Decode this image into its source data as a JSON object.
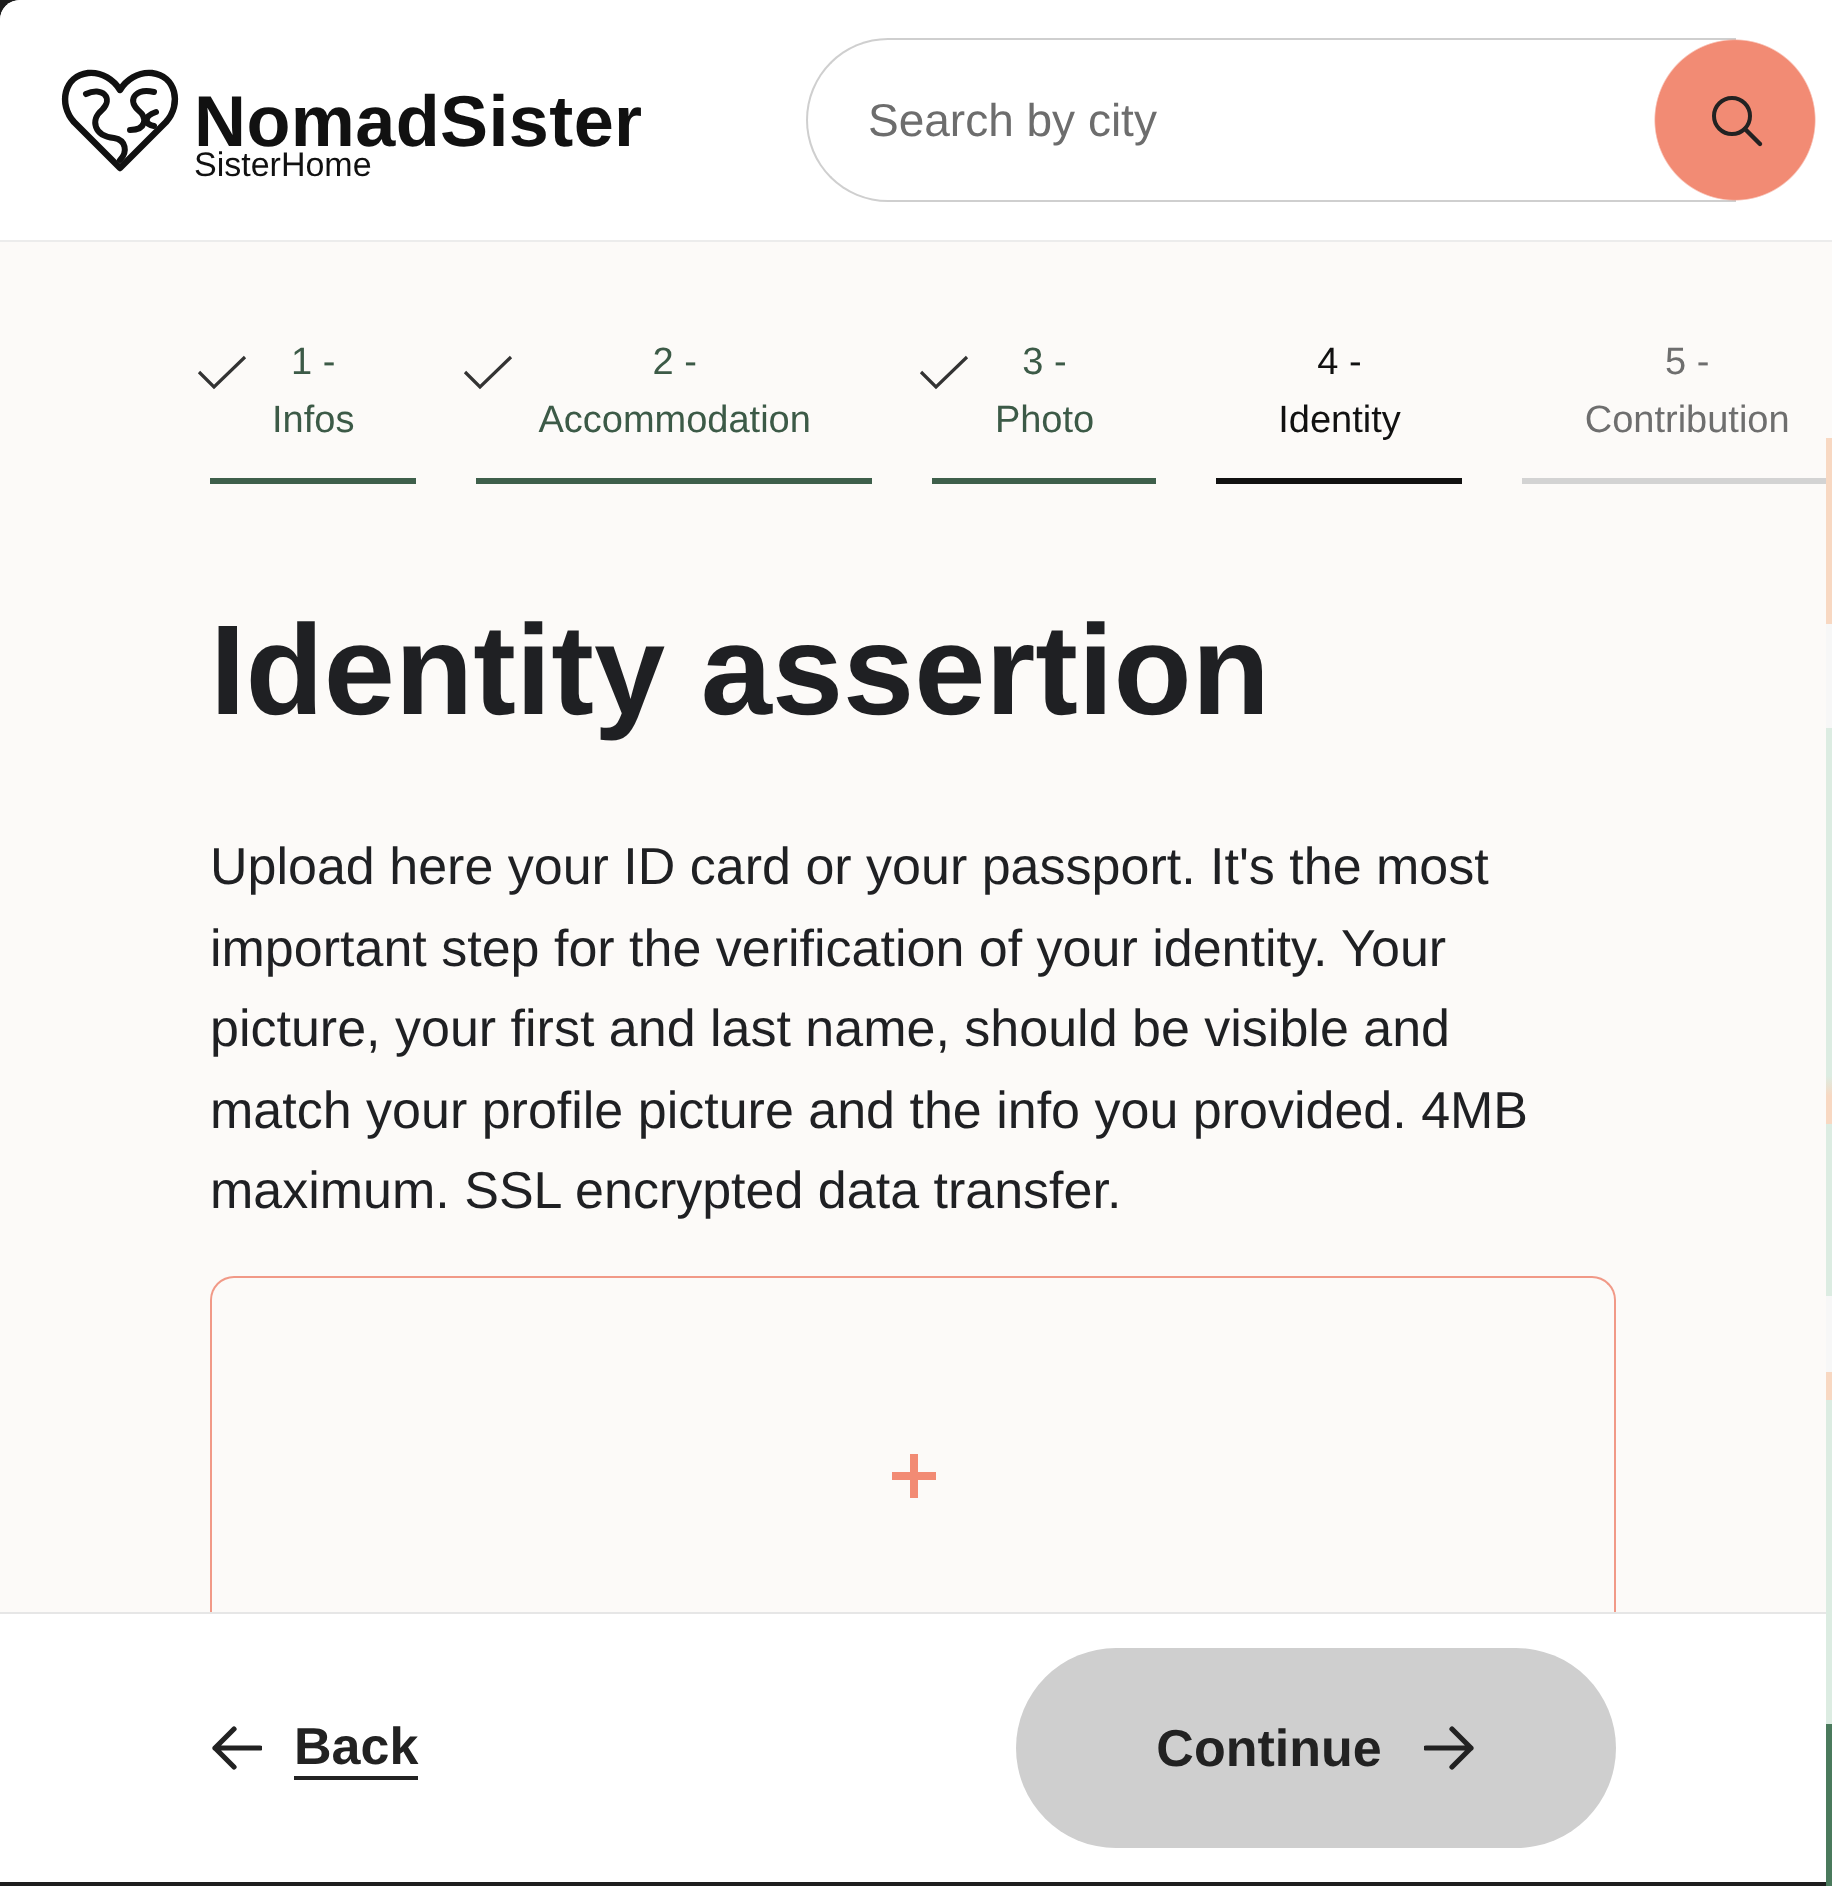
{
  "header": {
    "brand": {
      "name": "NomadSister",
      "tagline": "SisterHome"
    },
    "search": {
      "placeholder": "Search by city"
    }
  },
  "steps": [
    {
      "number": "1 -",
      "label": "Infos",
      "completed": true,
      "selected": false
    },
    {
      "number": "2 -",
      "label": "Accommodation",
      "completed": true,
      "selected": false
    },
    {
      "number": "3 -",
      "label": "Photo",
      "completed": true,
      "selected": false
    },
    {
      "number": "4 -",
      "label": "Identity",
      "completed": false,
      "selected": true
    },
    {
      "number": "5 -",
      "label": "Contribution",
      "completed": false,
      "selected": false
    }
  ],
  "page": {
    "title": "Identity assertion",
    "description": "Upload here your ID card or your passport. It's the most important step for the verification of your identity. Your picture, your first and last name, should be visible and match your profile picture and the info you provided. 4MB maximum. SSL encrypted data transfer."
  },
  "footer": {
    "back": {
      "label": "Back"
    },
    "continue": {
      "label": "Continue",
      "disabled": true
    }
  }
}
